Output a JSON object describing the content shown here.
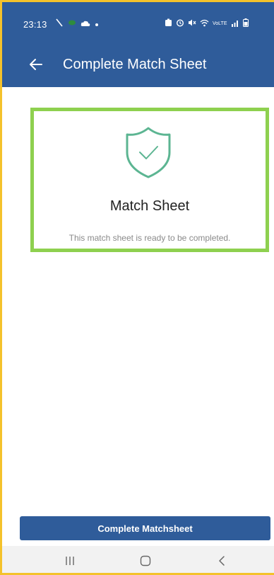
{
  "status_bar": {
    "time": "23:13",
    "left_icons": [
      "signal-icon",
      "leaf-icon",
      "cloud-icon",
      "dot-icon"
    ],
    "right_icons": [
      "battery-saver-icon",
      "alarm-icon",
      "mute-icon",
      "wifi-icon",
      "volte-icon",
      "signal-bars-icon",
      "battery-icon"
    ],
    "volte_text": "VoLTE"
  },
  "app_bar": {
    "back_icon": "arrow-left-icon",
    "title": "Complete Match Sheet"
  },
  "card": {
    "icon": "shield-check-icon",
    "title": "Match Sheet",
    "subtitle": "This match sheet is ready to be completed.",
    "highlight_color": "#8ed04f",
    "icon_color": "#5cb592"
  },
  "actions": {
    "complete_label": "Complete Matchsheet"
  },
  "nav_bar": {
    "items": [
      "recent-apps-icon",
      "home-icon",
      "back-icon"
    ]
  },
  "colors": {
    "primary": "#2f5c9a",
    "frame": "#f4c22b",
    "nav_background": "#f2f2f2"
  }
}
